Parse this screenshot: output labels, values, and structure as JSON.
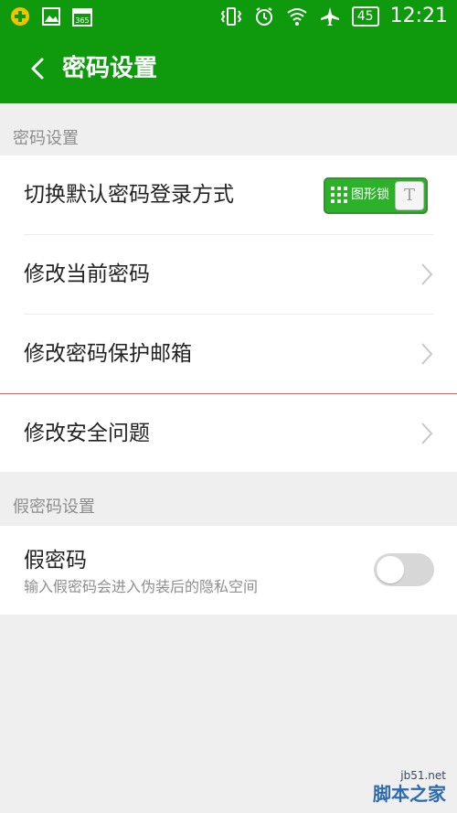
{
  "status_bar": {
    "time": "12:21",
    "battery": "45",
    "left_icons": [
      "plus-coin-icon",
      "image-icon",
      "calendar-365-icon"
    ],
    "right_icons": [
      "vibrate-icon",
      "alarm-icon",
      "wifi-icon",
      "airplane-icon"
    ],
    "calendar_label": "365"
  },
  "app_bar": {
    "title": "密码设置",
    "background": "#0f9a0e"
  },
  "sections": {
    "password": {
      "header": "密码设置",
      "items": [
        {
          "label": "切换默认密码登录方式",
          "toggle_label": "图形锁",
          "toggle_knob": "T"
        },
        {
          "label": "修改当前密码"
        },
        {
          "label": "修改密码保护邮箱"
        },
        {
          "label": "修改安全问题"
        }
      ]
    },
    "fake_password": {
      "header": "假密码设置",
      "title": "假密码",
      "subtitle": "输入假密码会进入伪装后的隐私空间",
      "enabled": false
    }
  },
  "watermark": {
    "domain": "jb51.net",
    "brand": "脚本之家"
  }
}
